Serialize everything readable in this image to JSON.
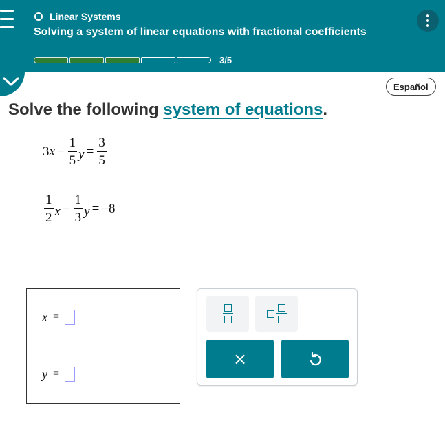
{
  "header": {
    "topic": "Linear Systems",
    "lesson_title": "Solving a system of linear equations with fractional coefficients",
    "progress": {
      "current": 3,
      "total": 5,
      "label": "3/5"
    }
  },
  "language_button": "Español",
  "prompt": {
    "before": "Solve the following ",
    "link": "system of equations",
    "after": "."
  },
  "equations": {
    "eq1": {
      "coef_x": "3",
      "var_x": "x",
      "minus": "−",
      "frac_y_num": "1",
      "frac_y_den": "5",
      "var_y": "y",
      "equals": "=",
      "rhs_num": "3",
      "rhs_den": "5"
    },
    "eq2": {
      "frac_x_num": "1",
      "frac_x_den": "2",
      "var_x": "x",
      "minus": "−",
      "frac_y_num": "1",
      "frac_y_den": "3",
      "var_y": "y",
      "equals": "=",
      "rhs": "−8"
    }
  },
  "answers": {
    "x": {
      "var": "x",
      "equals": "=",
      "value": ""
    },
    "y": {
      "var": "y",
      "equals": "=",
      "value": ""
    }
  },
  "keypad": {
    "clear_glyph": "×"
  },
  "colors": {
    "teal": "#007c8f",
    "progress_fill": "#2e7d32",
    "input_border": "#9c9cff"
  },
  "icons": [
    "menu-icon",
    "radio-circle-icon",
    "kebab-menu-icon",
    "chevron-down-icon",
    "fraction-icon",
    "mixed-number-icon",
    "clear-x-icon",
    "undo-icon"
  ]
}
